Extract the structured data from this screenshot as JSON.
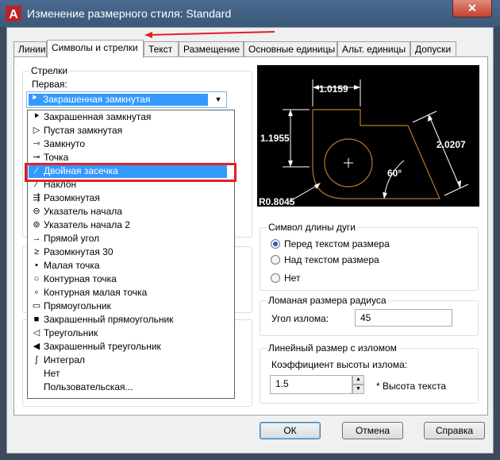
{
  "window": {
    "title": "Изменение размерного стиля: Standard",
    "close_glyph": "✕"
  },
  "tabs": [
    {
      "label": "Линии"
    },
    {
      "label": "Символы и стрелки"
    },
    {
      "label": "Текст"
    },
    {
      "label": "Размещение"
    },
    {
      "label": "Основные единицы"
    },
    {
      "label": "Альт. единицы"
    },
    {
      "label": "Допуски"
    }
  ],
  "arrows": {
    "group_label": "Стрелки",
    "first_label": "Первая:",
    "first_value": "Закрашенная замкнутая",
    "options": [
      {
        "icon": "filled-closed-arrow-icon",
        "glyph": "⯈",
        "label": "Закрашенная замкнутая"
      },
      {
        "icon": "open-closed-arrow-icon",
        "glyph": "▷",
        "label": "Пустая замкнутая"
      },
      {
        "icon": "closed-arrow-icon",
        "glyph": "⇾",
        "label": "Замкнуто"
      },
      {
        "icon": "dot-icon",
        "glyph": "⊸",
        "label": "Точка"
      },
      {
        "icon": "double-tick-icon",
        "glyph": "⁄",
        "label": "Двойная засечка"
      },
      {
        "icon": "oblique-icon",
        "glyph": "⁄",
        "label": "Наклон"
      },
      {
        "icon": "open-arrow-icon",
        "glyph": "⇶",
        "label": "Разомкнутая"
      },
      {
        "icon": "origin-indicator-icon",
        "glyph": "⊖",
        "label": "Указатель начала"
      },
      {
        "icon": "origin-indicator-2-icon",
        "glyph": "⊚",
        "label": "Указатель начала 2"
      },
      {
        "icon": "right-angle-icon",
        "glyph": "→",
        "label": "Прямой угол"
      },
      {
        "icon": "open-30-icon",
        "glyph": "≥",
        "label": "Разомкнутая 30"
      },
      {
        "icon": "small-dot-icon",
        "glyph": "•",
        "label": "Малая точка"
      },
      {
        "icon": "outline-dot-icon",
        "glyph": "○",
        "label": "Контурная точка"
      },
      {
        "icon": "small-outline-dot-icon",
        "glyph": "∘",
        "label": "Контурная малая точка"
      },
      {
        "icon": "box-icon",
        "glyph": "▭",
        "label": "Прямоугольник"
      },
      {
        "icon": "filled-box-icon",
        "glyph": "■",
        "label": "Закрашенный прямоугольник"
      },
      {
        "icon": "triangle-icon",
        "glyph": "◁",
        "label": "Треугольник"
      },
      {
        "icon": "filled-triangle-icon",
        "glyph": "◀",
        "label": "Закрашенный треугольник"
      },
      {
        "icon": "integral-icon",
        "glyph": "∫",
        "label": "Интеграл"
      },
      {
        "icon": "none-icon",
        "glyph": "",
        "label": "Нет"
      },
      {
        "icon": "user-arrow-icon",
        "glyph": "",
        "label": "Пользовательская..."
      }
    ],
    "highlighted_label": "Двойная засечка"
  },
  "preview": {
    "dim_top": "1.0159",
    "dim_left": "1.1955",
    "dim_right": "2.0207",
    "dim_angle": "60°",
    "dim_radius": "R0.8045"
  },
  "arc_symbol": {
    "label": "Символ длины дуги",
    "options": [
      {
        "label": "Перед текстом размера",
        "checked": true
      },
      {
        "label": "Над текстом размера",
        "checked": false
      },
      {
        "label": "Нет",
        "checked": false
      }
    ]
  },
  "radius_jog": {
    "label": "Ломаная размера радиуса",
    "angle_label": "Угол излома:",
    "angle_value": "45"
  },
  "linear_jog": {
    "label": "Линейный размер с изломом",
    "factor_label": "Коэффициент высоты излома:",
    "factor_value": "1.5",
    "factor_suffix": "* Высота текста"
  },
  "buttons": {
    "ok": "ОК",
    "cancel": "Отмена",
    "help": "Справка"
  }
}
